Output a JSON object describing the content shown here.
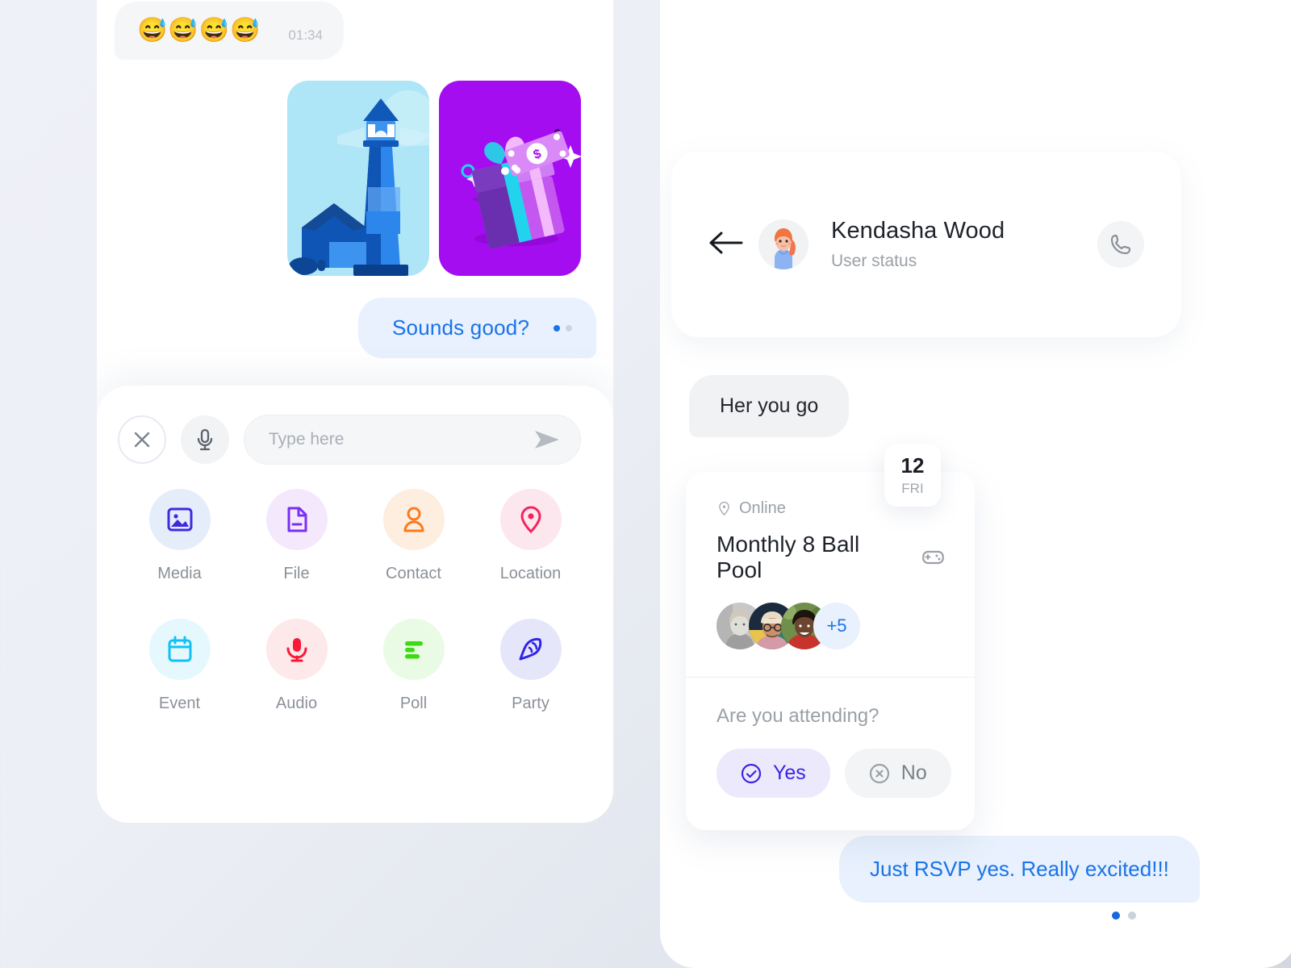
{
  "theme": {
    "page_bg_light": "#eef1f7",
    "page_bg_dark": "#d2d7e0",
    "accent_blue": "#1a73e8",
    "accent_indigo": "#3b25e0",
    "bubble_in_bg": "#f1f2f4",
    "bubble_out_bg": "#e8f1fd"
  },
  "left_panel": {
    "emoji_message": {
      "emojis": "😅😅😅😅",
      "time": "01:34"
    },
    "attachments": [
      {
        "name": "lighthouse-photo",
        "bg": "#aee6f7"
      },
      {
        "name": "gift-photo",
        "bg": "#a40df0"
      }
    ],
    "outgoing_message": {
      "text": "Sounds good?",
      "status_dots": 2
    },
    "composer": {
      "close_icon": "close-icon",
      "mic_icon": "microphone-icon",
      "input_value": "",
      "input_placeholder": "Type here",
      "send_icon": "send-icon"
    },
    "attachment_options": [
      {
        "label": "Media",
        "icon": "image-icon",
        "icon_color": "#3f2ae0",
        "bg": "#e5edfb"
      },
      {
        "label": "File",
        "icon": "document-icon",
        "icon_color": "#7b2ff2",
        "bg": "#f4e9fc"
      },
      {
        "label": "Contact",
        "icon": "person-icon",
        "icon_color": "#fc7a1e",
        "bg": "#fdeedf"
      },
      {
        "label": "Location",
        "icon": "map-pin-icon",
        "icon_color": "#f5225f",
        "bg": "#fde7ef"
      },
      {
        "label": "Event",
        "icon": "calendar-icon",
        "icon_color": "#13c0f5",
        "bg": "#e5f8fe"
      },
      {
        "label": "Audio",
        "icon": "microphone-icon",
        "icon_color": "#fb1735",
        "bg": "#fde8ea"
      },
      {
        "label": "Poll",
        "icon": "poll-bars-icon",
        "icon_color": "#3ddb12",
        "bg": "#e9fbe4"
      },
      {
        "label": "Party",
        "icon": "party-popper-icon",
        "icon_color": "#2f24e8",
        "bg": "#e6e6fb"
      }
    ]
  },
  "right_panel": {
    "header": {
      "back_icon": "back-arrow-icon",
      "avatar": "user-avatar",
      "name": "Kendasha Wood",
      "status": "User status",
      "call_icon": "phone-icon"
    },
    "messages": [
      {
        "from": "them",
        "text": "Her you go"
      },
      {
        "from": "me",
        "text": "Just RSVP yes. Really excited!!!"
      }
    ],
    "date_badge": {
      "day": "12",
      "weekday": "FRI"
    },
    "event_card": {
      "location_icon": "map-pin-icon",
      "location": "Online",
      "title": "Monthly 8 Ball Pool",
      "title_icon": "gamepad-icon",
      "attendees_overflow": "+5",
      "attendee_count": 3,
      "rsvp_question": "Are you attending?",
      "rsvp_yes_label": "Yes",
      "rsvp_yes_icon": "check-circle-icon",
      "rsvp_no_label": "No",
      "rsvp_no_icon": "x-circle-icon",
      "selected": "Yes"
    },
    "pagination": {
      "active_index": 0,
      "total": 2
    }
  }
}
